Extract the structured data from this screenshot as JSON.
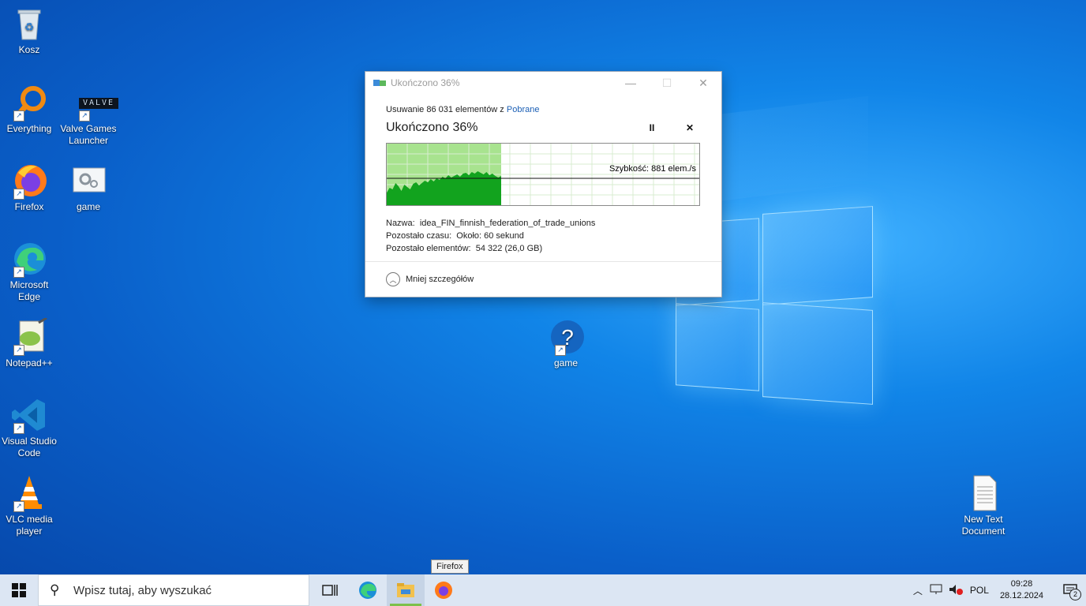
{
  "desktop": {
    "icons": [
      {
        "label": "Kosz"
      },
      {
        "label": "Everything"
      },
      {
        "label": "Valve Games Launcher"
      },
      {
        "label": "Firefox"
      },
      {
        "label": "game"
      },
      {
        "label": "Microsoft Edge"
      },
      {
        "label": "Notepad++"
      },
      {
        "label": "Visual Studio Code"
      },
      {
        "label": "VLC media player"
      },
      {
        "label": "game"
      },
      {
        "label": "New Text Document"
      }
    ],
    "valve_logo_text": "VALVE"
  },
  "dialog": {
    "title": "Ukończono 36%",
    "minimize_glyph": "—",
    "maximize_glyph": "☐",
    "close_glyph": "✕",
    "line1_prefix": "Usuwanie 86 031 elementów z",
    "line1_link": "Pobrane",
    "big_title": "Ukończono 36%",
    "pause_glyph": "II",
    "cancel_glyph": "✕",
    "speed": "Szybkość: 881 elem./s",
    "progress_fraction": 0.36,
    "name_label": "Nazwa:",
    "name_value": "idea_FIN_finnish_federation_of_trade_unions",
    "time_label": "Pozostało czasu:",
    "time_value": "Około: 60 sekund",
    "items_label": "Pozostało elementów:",
    "items_value": "54 322 (26,0 GB)",
    "less_details": "Mniej szczegółów"
  },
  "taskbar": {
    "search_placeholder": "Wpisz tutaj, aby wyszukać",
    "tooltip": "Firefox",
    "lang": "POL",
    "time": "09:28",
    "date": "28.12.2024",
    "notification_count": "2"
  },
  "colors": {
    "progress_fill": "#a8e38f",
    "graph_area": "#12a31e",
    "taskbar_bg": "#dce6f3",
    "link": "#1b5fb5"
  }
}
